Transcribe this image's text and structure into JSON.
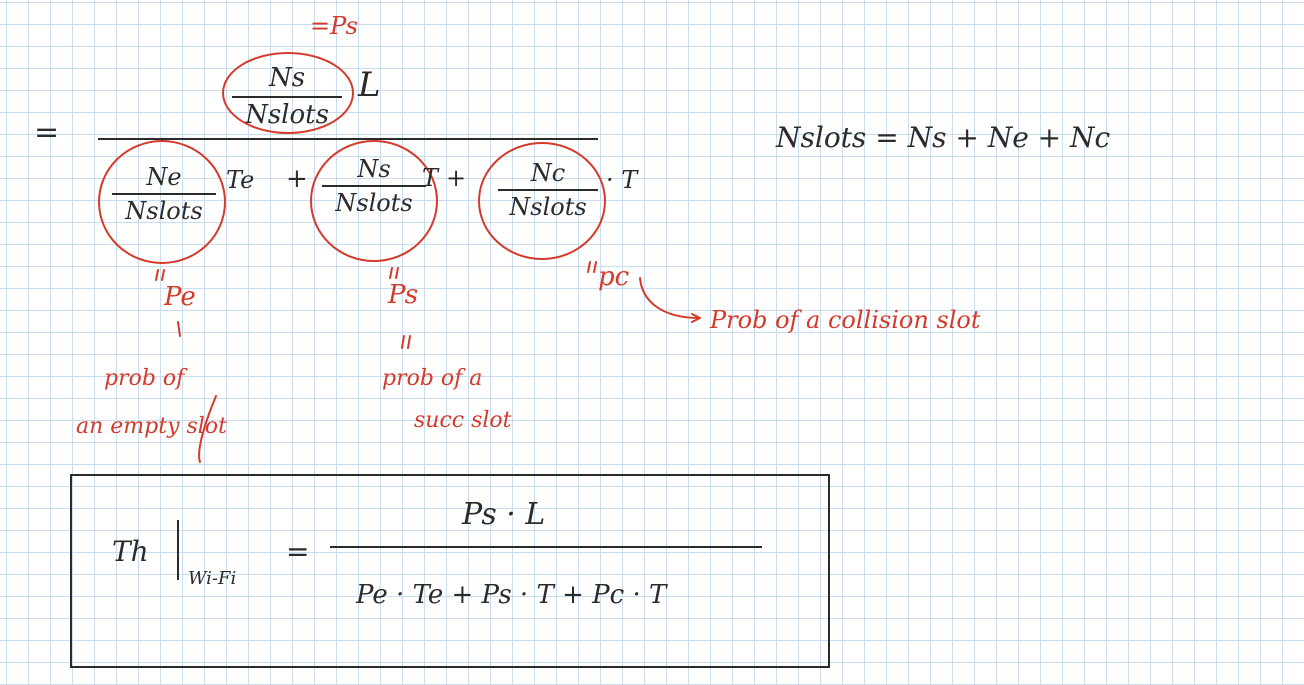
{
  "equals_sign": "=",
  "main_fraction": {
    "numerator": {
      "term": {
        "num": "Ns",
        "den": "Nslots"
      },
      "factor": "L",
      "annotation": "=Ps"
    },
    "denominator": {
      "terms": [
        {
          "num": "Ne",
          "den": "Nslots",
          "factor": "Te",
          "op": "+",
          "label": "Pe",
          "desc_line1": "prob of",
          "desc_line2": "an empty slot"
        },
        {
          "num": "Ns",
          "den": "Nslots",
          "factor": "T",
          "op": "+",
          "label": "Ps",
          "desc_line1": "prob of a",
          "desc_line2": "succ slot"
        },
        {
          "num": "Nc",
          "den": "Nslots",
          "factor": "· T",
          "op": "",
          "label": "pc",
          "desc_line1": "Prob of a collision slot",
          "desc_line2": ""
        }
      ]
    }
  },
  "slot_equation": "Nslots = Ns + Ne + Nc",
  "boxed_formula": {
    "lhs": "Th",
    "subscript": "Wi-Fi",
    "equals": "=",
    "numerator": "Ps · L",
    "denominator": "Pe · Te + Ps · T + Pc · T"
  },
  "colors": {
    "ink": "#2b2b2b",
    "annotation": "#d43a2a",
    "grid": "#c9dcf0"
  }
}
